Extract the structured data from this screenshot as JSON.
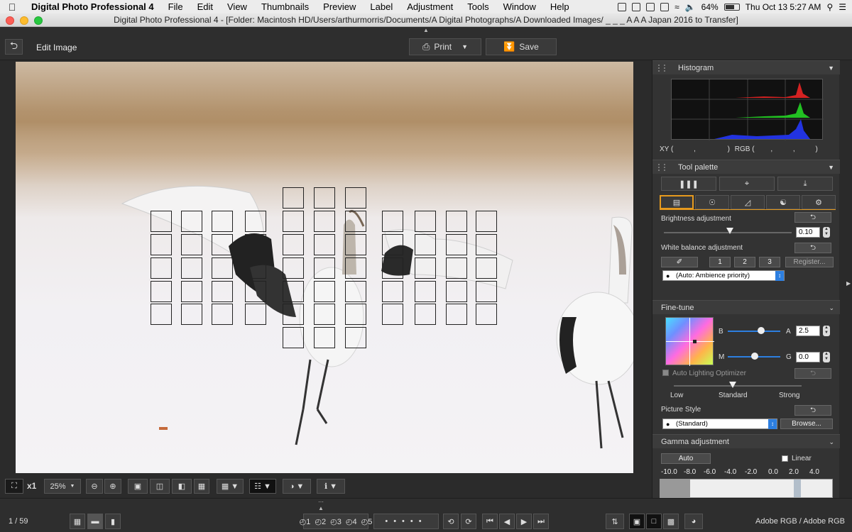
{
  "menubar": {
    "apple": "",
    "app_name": "Digital Photo Professional 4",
    "items": [
      "File",
      "Edit",
      "View",
      "Thumbnails",
      "Preview",
      "Label",
      "Adjustment",
      "Tools",
      "Window",
      "Help"
    ],
    "battery": "64%",
    "clock": "Thu Oct 13  5:27 AM"
  },
  "window": {
    "title": "Digital Photo Professional 4 - [Folder: Macintosh HD/Users/arthurmorris/Documents/A Digital Photographs/A Downloaded Images/ _ _ _ A A A Japan 2016 to Transfer]"
  },
  "toolbar": {
    "mode_label": "Edit Image",
    "print_label": "Print",
    "save_label": "Save"
  },
  "viewer_controls": {
    "zoom_multiplier": "x1",
    "zoom_level": "25%"
  },
  "status": {
    "image_counter": "1 / 59",
    "color_space": "Adobe RGB / Adobe RGB",
    "rating_1": "1",
    "rating_2": "2",
    "rating_3": "3",
    "rating_4": "4",
    "rating_5": "5"
  },
  "histogram": {
    "title": "Histogram",
    "xy_label": "XY (",
    "xy_sep1": ",",
    "xy_close": ")",
    "rgb_label": "RGB (",
    "rgb_sep1": ",",
    "rgb_sep2": ",",
    "rgb_close": ")"
  },
  "tool_palette": {
    "title": "Tool palette",
    "brightness_label": "Brightness adjustment",
    "brightness_value": "0.10",
    "white_balance_label": "White balance adjustment",
    "wb_custom_1": "1",
    "wb_custom_2": "2",
    "wb_custom_3": "3",
    "register_label": "Register...",
    "wb_select": "(Auto: Ambience priority)"
  },
  "fine_tune": {
    "title": "Fine-tune",
    "b_label": "B",
    "a_label": "A",
    "a_value": "2.5",
    "m_label": "M",
    "g_label": "G",
    "g_value": "0.0",
    "alo_label": "Auto Lighting Optimizer",
    "alo_low": "Low",
    "alo_standard": "Standard",
    "alo_strong": "Strong",
    "picture_style_label": "Picture Style",
    "picture_style_value": "(Standard)",
    "browse_label": "Browse..."
  },
  "gamma": {
    "title": "Gamma adjustment",
    "auto_label": "Auto",
    "linear_label": "Linear",
    "scale": [
      "-10.0",
      "-8.0",
      "-6.0",
      "-4.0",
      "-2.0",
      "0.0",
      "2.0",
      "4.0"
    ]
  },
  "colors": {
    "accent": "#2d7fe0",
    "tab_active": "#e69a1e"
  }
}
